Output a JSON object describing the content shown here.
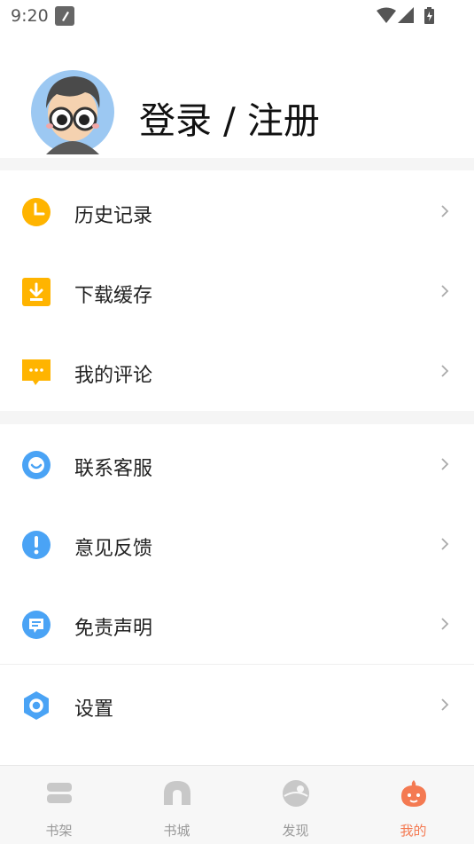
{
  "status_bar": {
    "time": "9:20"
  },
  "profile": {
    "login_text": "登录 / 注册"
  },
  "menu_groups": [
    [
      {
        "label": "历史记录",
        "icon": "clock-icon",
        "color": "#FFB400"
      },
      {
        "label": "下载缓存",
        "icon": "download-icon",
        "color": "#FFB400"
      },
      {
        "label": "我的评论",
        "icon": "comment-icon",
        "color": "#FFB400"
      }
    ],
    [
      {
        "label": "联系客服",
        "icon": "customer-service-icon",
        "color": "#4AA3F5"
      },
      {
        "label": "意见反馈",
        "icon": "feedback-icon",
        "color": "#4AA3F5"
      },
      {
        "label": "免责声明",
        "icon": "disclaimer-icon",
        "color": "#4AA3F5"
      },
      {
        "label": "设置",
        "icon": "settings-icon",
        "color": "#4AA3F5"
      }
    ]
  ],
  "tabs": [
    {
      "label": "书架",
      "icon": "bookshelf-icon",
      "active": false
    },
    {
      "label": "书城",
      "icon": "bookstore-icon",
      "active": false
    },
    {
      "label": "发现",
      "icon": "discover-icon",
      "active": false
    },
    {
      "label": "我的",
      "icon": "mine-icon",
      "active": true
    }
  ],
  "colors": {
    "accent": "#F47A52",
    "inactive": "#C8C8C8",
    "yellow": "#FFB400",
    "blue": "#4AA3F5"
  }
}
